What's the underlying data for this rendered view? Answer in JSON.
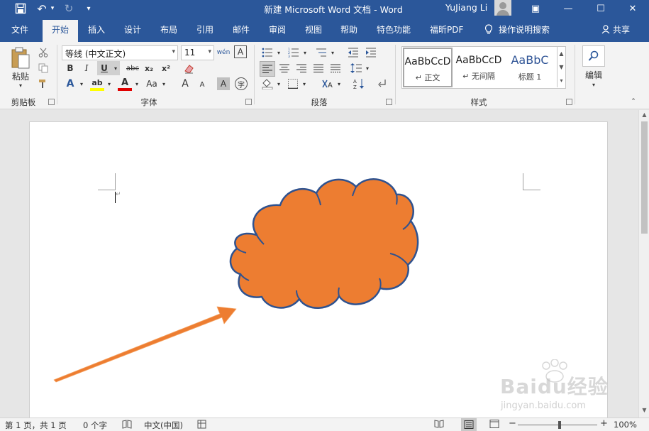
{
  "titlebar": {
    "title": "新建 Microsoft Word 文档  -  Word",
    "user": "YuJiang Li",
    "save_icon": "save-icon",
    "undo_glyph": "↶",
    "redo_glyph": "↻",
    "customize_glyph": "▾",
    "ribbon_display_glyph": "▣",
    "minimize_glyph": "—",
    "maximize_glyph": "☐",
    "close_glyph": "✕"
  },
  "menu": {
    "tabs": [
      "文件",
      "开始",
      "插入",
      "设计",
      "布局",
      "引用",
      "邮件",
      "审阅",
      "视图",
      "帮助",
      "特色功能",
      "福昕PDF"
    ],
    "tell_me": "操作说明搜索",
    "share": "共享"
  },
  "clipboard": {
    "paste_label": "粘贴",
    "group_label": "剪贴板"
  },
  "font": {
    "font_name": "等线 (中文正文)",
    "font_size": "11",
    "phonetic_glyph": "wén",
    "bold": "B",
    "italic": "I",
    "underline": "U",
    "strike": "abc",
    "subscript": "x₂",
    "superscript": "x²",
    "grow": "A",
    "shrink": "A",
    "change_case": "Aa",
    "char_shading": "A",
    "enclose": "字",
    "text_effect": "A",
    "highlight": "ab",
    "font_color": "A",
    "border_char": "A",
    "group_label": "字体"
  },
  "paragraph": {
    "group_label": "段落"
  },
  "styles": {
    "items": [
      {
        "sample": "AaBbCcD",
        "name": "↵ 正文"
      },
      {
        "sample": "AaBbCcD",
        "name": "↵ 无间隔"
      },
      {
        "sample": "AaBbC",
        "name": "标题 1"
      }
    ],
    "group_label": "样式"
  },
  "editing": {
    "label": "编辑"
  },
  "statusbar": {
    "page": "第 1 页，共 1 页",
    "words": "0 个字",
    "language": "中文(中国)",
    "zoom": "100%",
    "zoom_minus": "−",
    "zoom_plus": "+"
  },
  "document": {
    "paragraph_mark": "↵"
  },
  "watermark": {
    "text": "Baidu经验",
    "url": "jingyan.baidu.com"
  },
  "colors": {
    "accent": "#2b579a",
    "cloud_fill": "#ed7d31",
    "cloud_stroke": "#2f528f",
    "arrow_fill": "#ed7d31"
  }
}
